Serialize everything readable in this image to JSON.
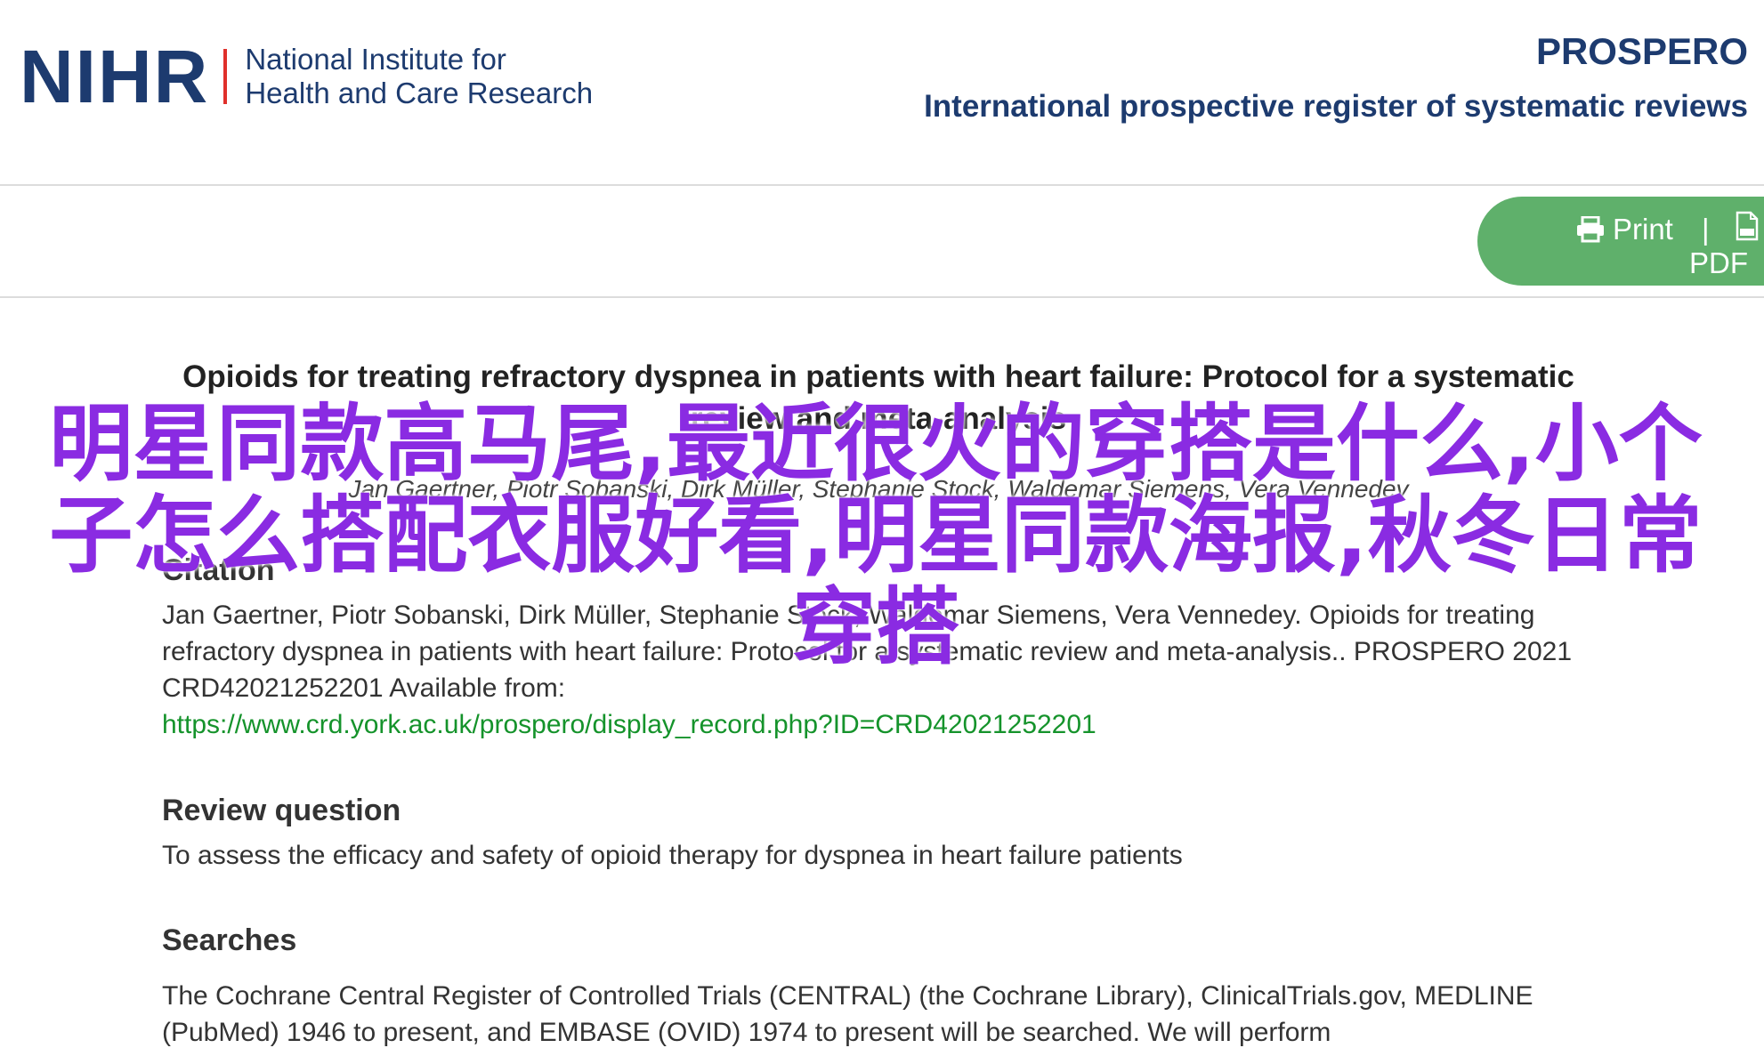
{
  "header": {
    "logo_mark": "NIHR",
    "logo_line1": "National Institute for",
    "logo_line2": "Health and Care Research",
    "brand_title": "PROSPERO",
    "brand_subtitle": "International prospective register of systematic reviews"
  },
  "toolbar": {
    "print_label": "Print",
    "separator": "|",
    "pdf_label": "PDF",
    "accent_color": "#5fb06b"
  },
  "record": {
    "title": "Opioids for treating refractory dyspnea in patients with heart failure: Protocol for a systematic review and meta-analysis",
    "authors": "Jan Gaertner, Piotr Sobanski, Dirk Müller, Stephanie Stock, Waldemar Siemens, Vera Vennedey",
    "citation": {
      "heading": "Citation",
      "text": "Jan Gaertner, Piotr Sobanski, Dirk Müller, Stephanie Stock, Waldemar Siemens, Vera Vennedey. Opioids for treating refractory dyspnea in patients with heart failure: Protocol for a systematic review and meta-analysis.. PROSPERO 2021 CRD42021252201 Available from:",
      "link": "https://www.crd.york.ac.uk/prospero/display_record.php?ID=CRD42021252201"
    },
    "review_question": {
      "heading": "Review question",
      "text": "To assess the efficacy and safety of opioid therapy for dyspnea in heart failure patients"
    },
    "searches": {
      "heading": "Searches",
      "text": "The Cochrane Central Register of Controlled Trials (CENTRAL) (the Cochrane Library), ClinicalTrials.gov, MEDLINE (PubMed) 1946 to present, and EMBASE (OVID) 1974 to present will be searched. We will perform"
    }
  },
  "overlay": {
    "text": "明星同款高马尾,最近很火的穿搭是什么,小个子怎么搭配衣服好看,明星同款海报,秋冬日常穿搭",
    "color": "#8a2be2"
  }
}
